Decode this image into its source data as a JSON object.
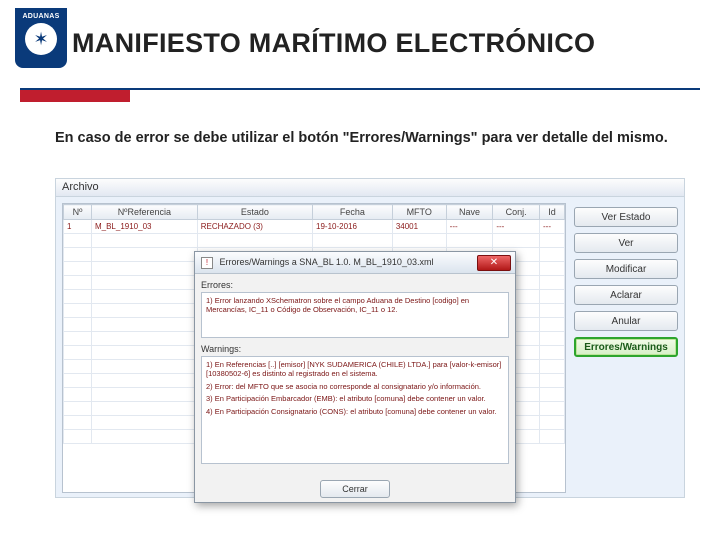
{
  "logo_text": "ADUANAS",
  "slide_title": "MANIFIESTO MARÍTIMO ELECTRÓNICO",
  "caption": "En caso de error se debe utilizar el botón \"Errores/Warnings\" para ver detalle del mismo.",
  "app": {
    "menu_archivo": "Archivo",
    "columns": [
      "Nº",
      "NºReferencia",
      "Estado",
      "Fecha",
      "MFTO",
      "Nave",
      "Conj.",
      "Id"
    ],
    "row": {
      "n": "1",
      "ref": "M_BL_1910_03",
      "estado": "RECHAZADO (3)",
      "fecha": "19-10-2016",
      "mfto": "34001",
      "nave": "---",
      "conj": "---",
      "id": "---"
    },
    "sidebar": {
      "ver_estado": "Ver Estado",
      "ver": "Ver",
      "modificar": "Modificar",
      "aclarar": "Aclarar",
      "anular": "Anular",
      "errores": "Errores/Warnings"
    }
  },
  "dialog": {
    "title": "Errores/Warnings a SNA_BL 1.0. M_BL_1910_03.xml",
    "errores_label": "Errores:",
    "errores_items": [
      "1) Error lanzando XSchematron sobre el campo Aduana de Destino [codigo] en Mercancías, IC_11 o Código de Observación, IC_11 o 12."
    ],
    "warnings_label": "Warnings:",
    "warnings_items": [
      "1) En Referencias [..] [emisor] [NYK SUDAMERICA (CHILE) LTDA.] para [valor-k-emisor] [10380502-6] es distinto al registrado en el sistema.",
      "2) Error: del MFTO que se asocia no corresponde al consignatario y/o información.",
      "3) En Participación Embarcador (EMB): el atributo [comuna] debe contener un valor.",
      "4) En Participación Consignatario (CONS): el atributo [comuna] debe contener un valor."
    ],
    "close_label": "Cerrar"
  }
}
